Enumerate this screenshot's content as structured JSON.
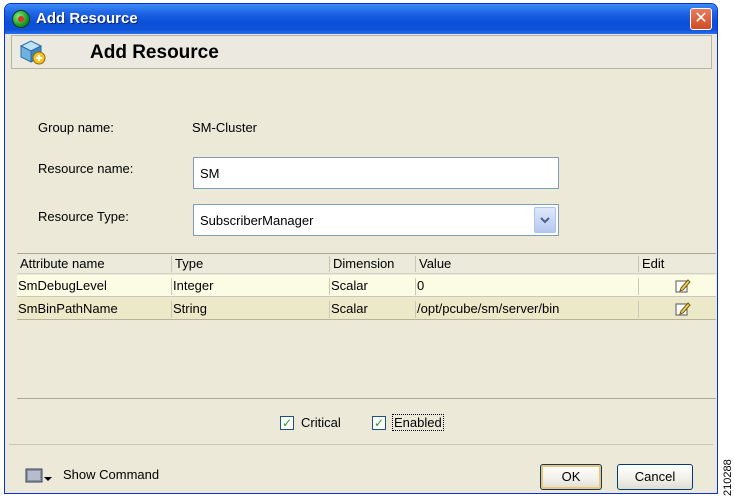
{
  "window": {
    "title": "Add Resource",
    "close_glyph": "✕"
  },
  "header": {
    "title": "Add Resource"
  },
  "form": {
    "group_name_label": "Group name:",
    "group_name_value": "SM-Cluster",
    "resource_name_label": "Resource name:",
    "resource_name_value": "SM",
    "resource_type_label": "Resource Type:",
    "resource_type_value": "SubscriberManager"
  },
  "table": {
    "columns": [
      "Attribute name",
      "Type",
      "Dimension",
      "Value",
      "Edit"
    ],
    "rows": [
      {
        "attribute": "SmDebugLevel",
        "type": "Integer",
        "dimension": "Scalar",
        "value": "0"
      },
      {
        "attribute": "SmBinPathName",
        "type": "String",
        "dimension": "Scalar",
        "value": "/opt/pcube/sm/server/bin"
      }
    ]
  },
  "options": {
    "critical_label": "Critical",
    "critical_checked": true,
    "enabled_label": "Enabled",
    "enabled_checked": true
  },
  "footer": {
    "show_command_label": "Show Command",
    "ok_label": "OK",
    "cancel_label": "Cancel"
  },
  "figure_id": "210288",
  "icons": [
    "app-icon",
    "close-icon",
    "add-resource-cube-icon",
    "dropdown-arrow-icon",
    "edit-icon",
    "show-command-icon"
  ]
}
